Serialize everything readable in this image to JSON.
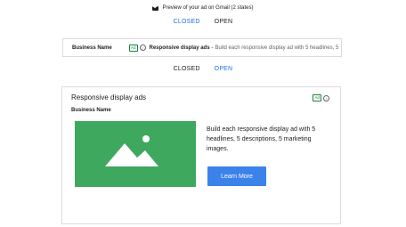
{
  "preview": {
    "text": "Preview of your ad on Gmail (2 states)",
    "icon": "mail-icon"
  },
  "toggle_top": {
    "closed": "CLOSED",
    "open": "OPEN",
    "active": "closed"
  },
  "collapsed": {
    "business_name": "Business Name",
    "badge": "Ad",
    "title": "Responsive display ads",
    "separator": "-",
    "description": "Build each responsive display ad with 5 headlines, 5"
  },
  "toggle_bottom": {
    "closed": "CLOSED",
    "open": "OPEN",
    "active": "open"
  },
  "expanded": {
    "title": "Responsive display ads",
    "badge": "Ad",
    "business_name": "Business Name",
    "image_icon": "image-placeholder-icon",
    "description": "Build each responsive display ad with 5 headlines, 5 descriptions, 5 marketing images.",
    "cta": "Learn More"
  },
  "colors": {
    "accent": "#1a73e8",
    "image_bg": "#3ea85e",
    "button_bg": "#3b82ea",
    "ad_badge": "#188038"
  }
}
